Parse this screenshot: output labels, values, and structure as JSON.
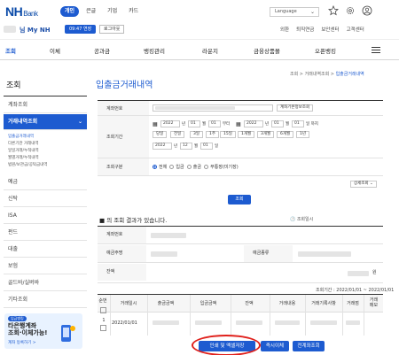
{
  "header": {
    "logo_main": "NH",
    "logo_sub": "Bank",
    "tabs": [
      "개인",
      "큰글",
      "기업",
      "카드"
    ],
    "language": "Language",
    "icons": [
      "star-icon",
      "gear-icon",
      "user-circle-icon"
    ]
  },
  "userbar": {
    "my_home": "님 My NH",
    "timer": "09:47 연장",
    "logout": "로그아웃",
    "links": [
      "외환",
      "퇴직연금",
      "보안센터",
      "고객센터"
    ]
  },
  "gnb": {
    "items": [
      "조회",
      "이체",
      "공과금",
      "뱅킹관리",
      "라운지",
      "금융상품몰",
      "오픈뱅킹"
    ]
  },
  "sidebar": {
    "title": "조회",
    "items": [
      "계좌조회",
      "거래내역조회",
      "예금",
      "신탁",
      "ISA",
      "펀드",
      "대출",
      "보험",
      "골드바/실버바",
      "기타조회"
    ],
    "subitems": [
      "입출금거래내역",
      "다른기관 거래내역",
      "일일거래/누적내역",
      "월별거래/누적내역",
      "법원/보관금/공탁금내역"
    ],
    "ad": {
      "badge": "입금뱅킹",
      "title": "타은행계좌\n조회·이체가능!",
      "link": "계좌 등록하기 >"
    }
  },
  "breadcrumb": [
    "조회",
    "거래내역조회",
    "입출금거래내역"
  ],
  "page_title": "입출금거래내역",
  "form": {
    "account_label": "계좌번호",
    "account_button": "계좌기본정보조회",
    "period_label": "조회기간",
    "from_year": "2022",
    "from_month": "01",
    "from_day": "01",
    "to_year": "2022",
    "to_month": "01",
    "to_day": "01",
    "from_suffix": "부터",
    "to_suffix": "일 까지",
    "year_unit": "년",
    "month_unit": "월",
    "day_unit": "일",
    "quick_buttons": [
      "당일",
      "전일",
      "3일",
      "1주",
      "15일",
      "1개월",
      "3개월",
      "6개월",
      "1년"
    ],
    "time_year": "2022",
    "time_month": "12",
    "time_day": "01",
    "type_label": "조회구분",
    "type_options": [
      "전체",
      "입금",
      "출금",
      "무통장(미기장)"
    ],
    "detail_toggle": "상세조회",
    "submit": "조회"
  },
  "result": {
    "headline": "의 조회 결과가 있습니다.",
    "time_label": "조회일시",
    "rows": [
      "계좌번호",
      "예금주명",
      "잔액"
    ],
    "balance_label_right": "예금종류",
    "balance_suffix": "원",
    "period_text": "조회기간 : 2022/01/01 ~ 2022/01/01"
  },
  "list": {
    "columns": [
      "순번",
      "거래일시",
      "출금금액",
      "입금금액",
      "잔액",
      "거래내용",
      "거래기록사항",
      "거래점",
      "거래\n메모"
    ],
    "rows": [
      {
        "no": "1",
        "date": "2022/01/01"
      }
    ]
  },
  "buttons": {
    "print": "인쇄 및 엑셀저장",
    "excel": "즉시이체",
    "all": "전계좌조회"
  },
  "colors": {
    "brand": "#1d5bd0",
    "highlight": "#e0201b"
  }
}
